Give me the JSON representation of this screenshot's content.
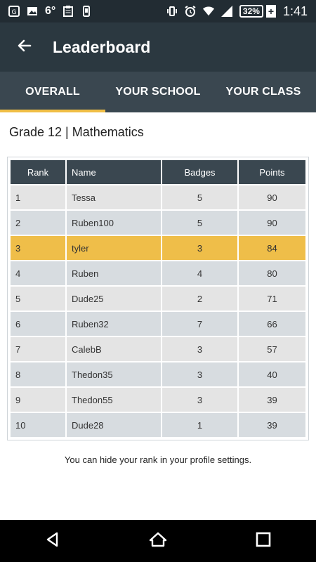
{
  "status_bar": {
    "temperature": "6°",
    "battery_percent": "32%",
    "battery_charging_glyph": "+",
    "time": "1:41",
    "left_icons": [
      "app-notification-icon",
      "image-icon",
      "clipboard-icon",
      "phone-signal-icon"
    ],
    "right_icons": [
      "vibrate-icon",
      "alarm-icon",
      "wifi-icon",
      "cellular-icon",
      "battery-icon"
    ]
  },
  "app_bar": {
    "title": "Leaderboard",
    "back_icon": "arrow-left-icon"
  },
  "tabs": [
    {
      "label": "OVERALL",
      "active": true
    },
    {
      "label": "YOUR SCHOOL",
      "active": false
    },
    {
      "label": "YOUR CLASS",
      "active": false
    }
  ],
  "grade_title": "Grade 12 | Mathematics",
  "table": {
    "headers": {
      "rank": "Rank",
      "name": "Name",
      "badges": "Badges",
      "points": "Points"
    },
    "rows": [
      {
        "rank": "1",
        "name": "Tessa",
        "badges": "5",
        "points": "90"
      },
      {
        "rank": "2",
        "name": "Ruben100",
        "badges": "5",
        "points": "90"
      },
      {
        "rank": "3",
        "name": "tyler",
        "badges": "3",
        "points": "84",
        "highlight": true
      },
      {
        "rank": "4",
        "name": "Ruben",
        "badges": "4",
        "points": "80"
      },
      {
        "rank": "5",
        "name": "Dude25",
        "badges": "2",
        "points": "71"
      },
      {
        "rank": "6",
        "name": "Ruben32",
        "badges": "7",
        "points": "66"
      },
      {
        "rank": "7",
        "name": "CalebB",
        "badges": "3",
        "points": "57"
      },
      {
        "rank": "8",
        "name": "Thedon35",
        "badges": "3",
        "points": "40"
      },
      {
        "rank": "9",
        "name": "Thedon55",
        "badges": "3",
        "points": "39"
      },
      {
        "rank": "10",
        "name": "Dude28",
        "badges": "1",
        "points": "39"
      }
    ]
  },
  "footer_note": "You can hide your rank in your profile settings.",
  "colors": {
    "accent": "#f0be45",
    "app_bar": "#2b3840",
    "tab_bar": "#3a4750",
    "highlight_row": "#efbe49"
  },
  "nav_bar": {
    "icons": [
      "back-triangle-icon",
      "home-icon",
      "recents-icon"
    ]
  }
}
